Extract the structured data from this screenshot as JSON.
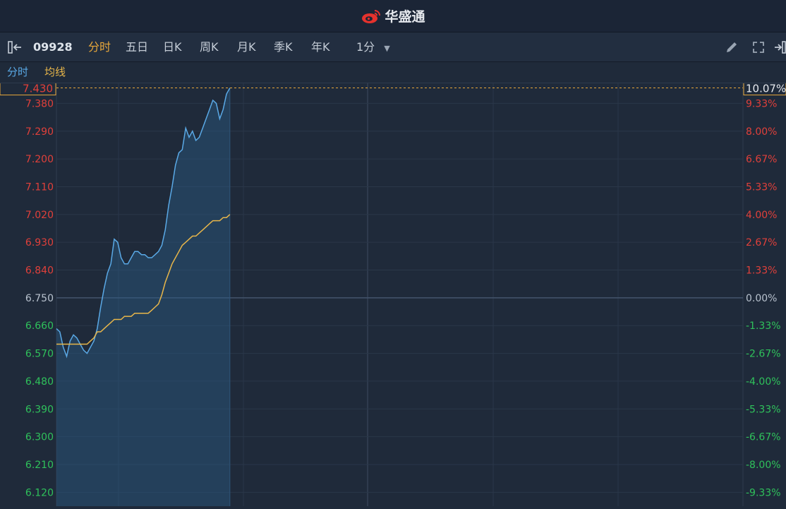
{
  "header": {
    "brand": "华盛通"
  },
  "toolbar": {
    "code": "09928",
    "tabs": [
      "分时",
      "五日",
      "日K",
      "周K",
      "月K",
      "季K",
      "年K"
    ],
    "active_tab": "分时",
    "interval": "1分"
  },
  "subbar": {
    "series_a": "分时",
    "series_b": "均线"
  },
  "colors": {
    "price_line": "#5aa9e6",
    "avg_line": "#e8b64a",
    "up": "#e0403a",
    "down": "#2fc15b",
    "neutral": "#b8c2ce",
    "current": "#e7a73a"
  },
  "chart_data": {
    "type": "line",
    "prev_close": 6.75,
    "current_price": "7.430",
    "current_change": "10.07%",
    "ylim": [
      6.075,
      7.445
    ],
    "left_ticks": [
      "7.380",
      "7.290",
      "7.200",
      "7.110",
      "7.020",
      "6.930",
      "6.840",
      "6.750",
      "6.660",
      "6.570",
      "6.480",
      "6.390",
      "6.300",
      "6.210",
      "6.120"
    ],
    "right_ticks": [
      "9.33%",
      "8.00%",
      "6.67%",
      "5.33%",
      "4.00%",
      "2.67%",
      "1.33%",
      "0.00%",
      "-1.33%",
      "-2.67%",
      "-4.00%",
      "-5.33%",
      "-6.67%",
      "-8.00%",
      "-9.33%"
    ],
    "grid": true,
    "series": [
      {
        "values": [
          6.65,
          6.64,
          6.59,
          6.56,
          6.61,
          6.63,
          6.62,
          6.6,
          6.58,
          6.57,
          6.59,
          6.61,
          6.65,
          6.72,
          6.78,
          6.83,
          6.86,
          6.94,
          6.93,
          6.88,
          6.86,
          6.86,
          6.88,
          6.9,
          6.9,
          6.89,
          6.89,
          6.88,
          6.88,
          6.89,
          6.9,
          6.92,
          6.97,
          7.05,
          7.11,
          7.18,
          7.22,
          7.23,
          7.3,
          7.27,
          7.29,
          7.26,
          7.27,
          7.3,
          7.33,
          7.36,
          7.39,
          7.38,
          7.33,
          7.36,
          7.41,
          7.43
        ]
      },
      {
        "values": [
          6.6,
          6.6,
          6.6,
          6.6,
          6.6,
          6.6,
          6.6,
          6.6,
          6.6,
          6.6,
          6.61,
          6.62,
          6.64,
          6.64,
          6.65,
          6.66,
          6.67,
          6.68,
          6.68,
          6.68,
          6.69,
          6.69,
          6.69,
          6.7,
          6.7,
          6.7,
          6.7,
          6.7,
          6.71,
          6.72,
          6.73,
          6.76,
          6.8,
          6.83,
          6.86,
          6.88,
          6.9,
          6.92,
          6.93,
          6.94,
          6.95,
          6.95,
          6.96,
          6.97,
          6.98,
          6.99,
          7.0,
          7.0,
          7.0,
          7.01,
          7.01,
          7.02
        ]
      }
    ]
  }
}
